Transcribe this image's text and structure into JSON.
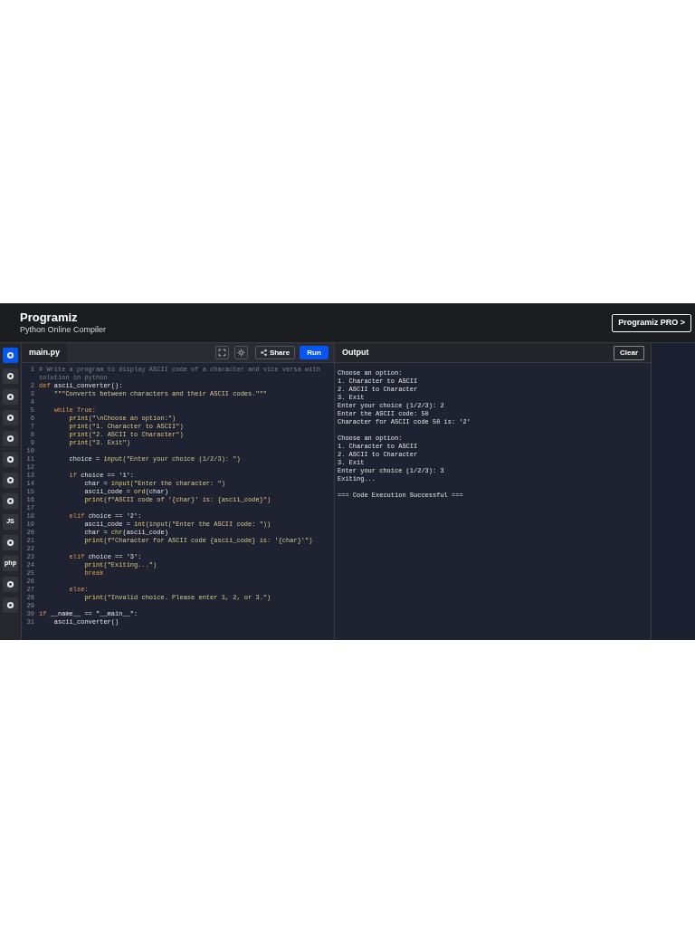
{
  "header": {
    "logo": "Programiz",
    "subtitle": "Python Online Compiler",
    "pro_button": "Programiz PRO >"
  },
  "sidebar": {
    "items": [
      {
        "kind": "icon",
        "selected": true
      },
      {
        "kind": "icon",
        "selected": false
      },
      {
        "kind": "icon",
        "selected": false
      },
      {
        "kind": "icon",
        "selected": false
      },
      {
        "kind": "icon",
        "selected": false
      },
      {
        "kind": "icon",
        "selected": false
      },
      {
        "kind": "icon",
        "selected": false
      },
      {
        "kind": "icon",
        "selected": false
      },
      {
        "kind": "text",
        "label": "JS",
        "selected": false
      },
      {
        "kind": "icon",
        "selected": false
      },
      {
        "kind": "text",
        "label": "php",
        "selected": false
      },
      {
        "kind": "icon",
        "selected": false
      },
      {
        "kind": "icon",
        "selected": false
      }
    ]
  },
  "editor": {
    "tab": "main.py",
    "share_button": "Share",
    "run_button": "Run",
    "lines": [
      {
        "number": "1",
        "segments": [
          {
            "text": "# Write a program to display ASCII code of a character and vice versa with solution in python",
            "kind": "comment"
          }
        ]
      },
      {
        "number": "2",
        "segments": [
          {
            "text": "def ",
            "kind": "keyword"
          },
          {
            "text": "ascii_converter():",
            "kind": "plain"
          }
        ]
      },
      {
        "number": "3",
        "segments": [
          {
            "text": "    \"\"\"Converts between characters and their ASCII codes.\"\"\"",
            "kind": "string"
          }
        ]
      },
      {
        "number": "4"
      },
      {
        "number": "5",
        "segments": [
          {
            "text": "    while True:",
            "kind": "keyword"
          }
        ]
      },
      {
        "number": "6",
        "segments": [
          {
            "text": "        print",
            "kind": "func"
          },
          {
            "text": "(\"\\nChoose an option:\")",
            "kind": "string"
          }
        ]
      },
      {
        "number": "7",
        "segments": [
          {
            "text": "        print",
            "kind": "func"
          },
          {
            "text": "(\"1. Character to ASCII\")",
            "kind": "string"
          }
        ]
      },
      {
        "number": "8",
        "segments": [
          {
            "text": "        print",
            "kind": "func"
          },
          {
            "text": "(\"2. ASCII to Character\")",
            "kind": "string"
          }
        ]
      },
      {
        "number": "9",
        "segments": [
          {
            "text": "        print",
            "kind": "func"
          },
          {
            "text": "(\"3. Exit\")",
            "kind": "string"
          }
        ]
      },
      {
        "number": "10"
      },
      {
        "number": "11",
        "segments": [
          {
            "text": "        choice = ",
            "kind": "plain"
          },
          {
            "text": "input",
            "kind": "func"
          },
          {
            "text": "(\"Enter your choice (1/2/3): \")",
            "kind": "string"
          }
        ]
      },
      {
        "number": "12"
      },
      {
        "number": "13",
        "segments": [
          {
            "text": "        if ",
            "kind": "keyword"
          },
          {
            "text": "choice == '1':",
            "kind": "plain"
          }
        ]
      },
      {
        "number": "14",
        "segments": [
          {
            "text": "            char = ",
            "kind": "plain"
          },
          {
            "text": "input",
            "kind": "func"
          },
          {
            "text": "(\"Enter the character: \")",
            "kind": "string"
          }
        ]
      },
      {
        "number": "15",
        "segments": [
          {
            "text": "            ascii_code = ",
            "kind": "plain"
          },
          {
            "text": "ord",
            "kind": "func"
          },
          {
            "text": "(char)",
            "kind": "plain"
          }
        ]
      },
      {
        "number": "16",
        "segments": [
          {
            "text": "            print",
            "kind": "func"
          },
          {
            "text": "(f\"ASCII code of '{char}' is: {ascii_code}\")",
            "kind": "string"
          }
        ]
      },
      {
        "number": "17"
      },
      {
        "number": "18",
        "segments": [
          {
            "text": "        elif ",
            "kind": "keyword"
          },
          {
            "text": "choice == '2':",
            "kind": "plain"
          }
        ]
      },
      {
        "number": "19",
        "segments": [
          {
            "text": "            ascii_code = ",
            "kind": "plain"
          },
          {
            "text": "int",
            "kind": "func"
          },
          {
            "text": "(input(\"Enter the ASCII code: \"))",
            "kind": "string"
          }
        ]
      },
      {
        "number": "20",
        "segments": [
          {
            "text": "            char = ",
            "kind": "plain"
          },
          {
            "text": "chr",
            "kind": "func"
          },
          {
            "text": "(ascii_code)",
            "kind": "plain"
          }
        ]
      },
      {
        "number": "21",
        "segments": [
          {
            "text": "            print",
            "kind": "func"
          },
          {
            "text": "(f\"Character for ASCII code {ascii_code} is: '{char}'\")",
            "kind": "string"
          }
        ]
      },
      {
        "number": "22"
      },
      {
        "number": "23",
        "segments": [
          {
            "text": "        elif ",
            "kind": "keyword"
          },
          {
            "text": "choice == '3':",
            "kind": "plain"
          }
        ]
      },
      {
        "number": "24",
        "segments": [
          {
            "text": "            print",
            "kind": "func"
          },
          {
            "text": "(\"Exiting...\")",
            "kind": "string"
          }
        ]
      },
      {
        "number": "25",
        "segments": [
          {
            "text": "            break",
            "kind": "keyword"
          }
        ]
      },
      {
        "number": "26"
      },
      {
        "number": "27",
        "segments": [
          {
            "text": "        else:",
            "kind": "keyword"
          }
        ]
      },
      {
        "number": "28",
        "segments": [
          {
            "text": "            print",
            "kind": "func"
          },
          {
            "text": "(\"Invalid choice. Please enter 1, 2, or 3.\")",
            "kind": "string"
          }
        ]
      },
      {
        "number": "29"
      },
      {
        "number": "30",
        "segments": [
          {
            "text": "if ",
            "kind": "keyword"
          },
          {
            "text": "__name__ == \"__main__\":",
            "kind": "plain"
          }
        ]
      },
      {
        "number": "31",
        "segments": [
          {
            "text": "    ascii_converter()",
            "kind": "plain"
          }
        ]
      }
    ]
  },
  "output": {
    "title": "Output",
    "clear_button": "Clear",
    "blocks": [
      [
        "Choose an option:",
        "1. Character to ASCII",
        "2. ASCII to Character",
        "3. Exit",
        "Enter your choice (1/2/3): 2",
        "Enter the ASCII code: 50",
        "Character for ASCII code 50 is: '2'"
      ],
      [
        "Choose an option:",
        "1. Character to ASCII",
        "2. ASCII to Character",
        "3. Exit",
        "Enter your choice (1/2/3): 3",
        "Exiting..."
      ],
      [
        "=== Code Execution Successful ==="
      ]
    ]
  }
}
